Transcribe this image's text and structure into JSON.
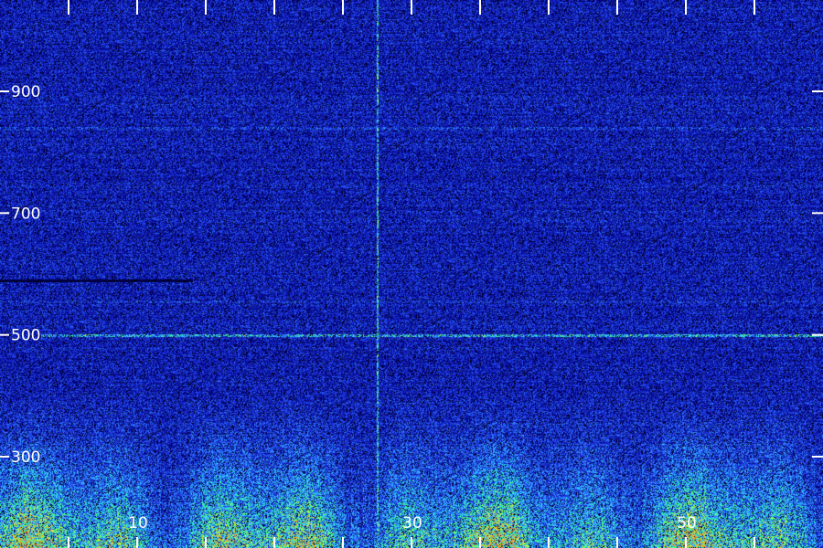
{
  "chart_data": {
    "type": "heatmap",
    "title": "",
    "xlabel": "",
    "ylabel": "",
    "x_tick_labels": [
      "10",
      "30",
      "50"
    ],
    "x_tick_values": [
      10,
      30,
      50
    ],
    "x_minor_ticks": [
      0,
      5,
      10,
      15,
      20,
      25,
      30,
      35,
      40,
      45,
      50,
      55
    ],
    "xlim": [
      0,
      60
    ],
    "y_tick_labels": [
      "300",
      "500",
      "700",
      "900"
    ],
    "y_tick_values": [
      300,
      500,
      700,
      900
    ],
    "y_minor_ticks": [
      300,
      500,
      700,
      900
    ],
    "ylim": [
      150,
      1050
    ],
    "grid": false,
    "legend": "none",
    "colormap": [
      "#000000",
      "#00007a",
      "#1a2bd6",
      "#2f7bff",
      "#33d4ff",
      "#39ff7a",
      "#d8ff33",
      "#ff8a1a"
    ],
    "background_level": 0.26,
    "low_frequency_energy": {
      "peak_y": 160,
      "peak_level": 0.78,
      "decay_to_y": 420
    },
    "horizontal_lines": [
      {
        "y": 500,
        "level": 0.55,
        "x_range": [
          3,
          60
        ]
      },
      {
        "y": 840,
        "level": 0.34,
        "x_range": [
          0,
          60
        ]
      },
      {
        "y": 555,
        "level": 0.32,
        "x_range": [
          0,
          60
        ]
      },
      {
        "y": 590,
        "level": 0.06,
        "x_range": [
          0,
          14
        ]
      }
    ],
    "vertical_lines": [
      {
        "x": 27.5,
        "level": 0.62,
        "y_range": [
          150,
          1050
        ]
      },
      {
        "x": 28.2,
        "level": 0.18,
        "y_range": [
          150,
          1050
        ]
      }
    ]
  }
}
